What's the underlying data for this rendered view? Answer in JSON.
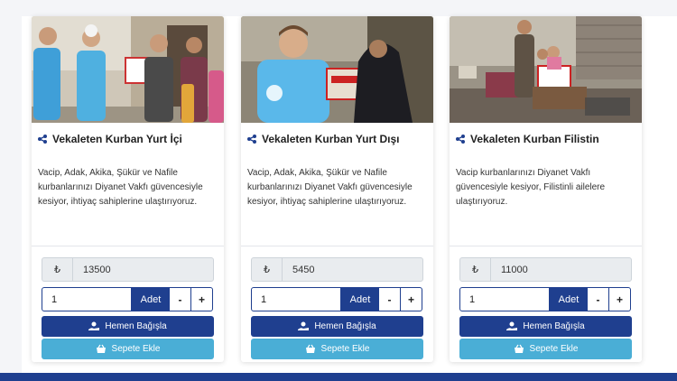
{
  "colors": {
    "primary": "#1f3f8f",
    "secondary": "#4aaed6",
    "page_background": "#f4f5f8"
  },
  "cards": [
    {
      "title": "Vekaleten Kurban Yurt İçi",
      "description": "Vacip, Adak, Akika, Şükür ve Nafile kurbanlarınızı Diyanet Vakfı güvencesiyle kesiyor, ihtiyaç sahiplerine ulaştırıyoruz.",
      "currency": "₺",
      "price": "13500",
      "quantity": "1",
      "unit_label": "Adet",
      "minus_label": "-",
      "plus_label": "+",
      "donate_label": "Hemen Bağışla",
      "cart_label": "Sepete Ekle"
    },
    {
      "title": "Vekaleten Kurban Yurt Dışı",
      "description": "Vacip, Adak, Akika, Şükür ve Nafile kurbanlarınızı Diyanet Vakfı güvencesiyle kesiyor, ihtiyaç sahiplerine ulaştırıyoruz.",
      "currency": "₺",
      "price": "5450",
      "quantity": "1",
      "unit_label": "Adet",
      "minus_label": "-",
      "plus_label": "+",
      "donate_label": "Hemen Bağışla",
      "cart_label": "Sepete Ekle"
    },
    {
      "title": "Vekaleten Kurban Filistin",
      "description": "Vacip kurbanlarınızı Diyanet Vakfı güvencesiyle kesiyor, Filistinli ailelere ulaştırıyoruz.",
      "currency": "₺",
      "price": "11000",
      "quantity": "1",
      "unit_label": "Adet",
      "minus_label": "-",
      "plus_label": "+",
      "donate_label": "Hemen Bağışla",
      "cart_label": "Sepete Ekle"
    }
  ]
}
